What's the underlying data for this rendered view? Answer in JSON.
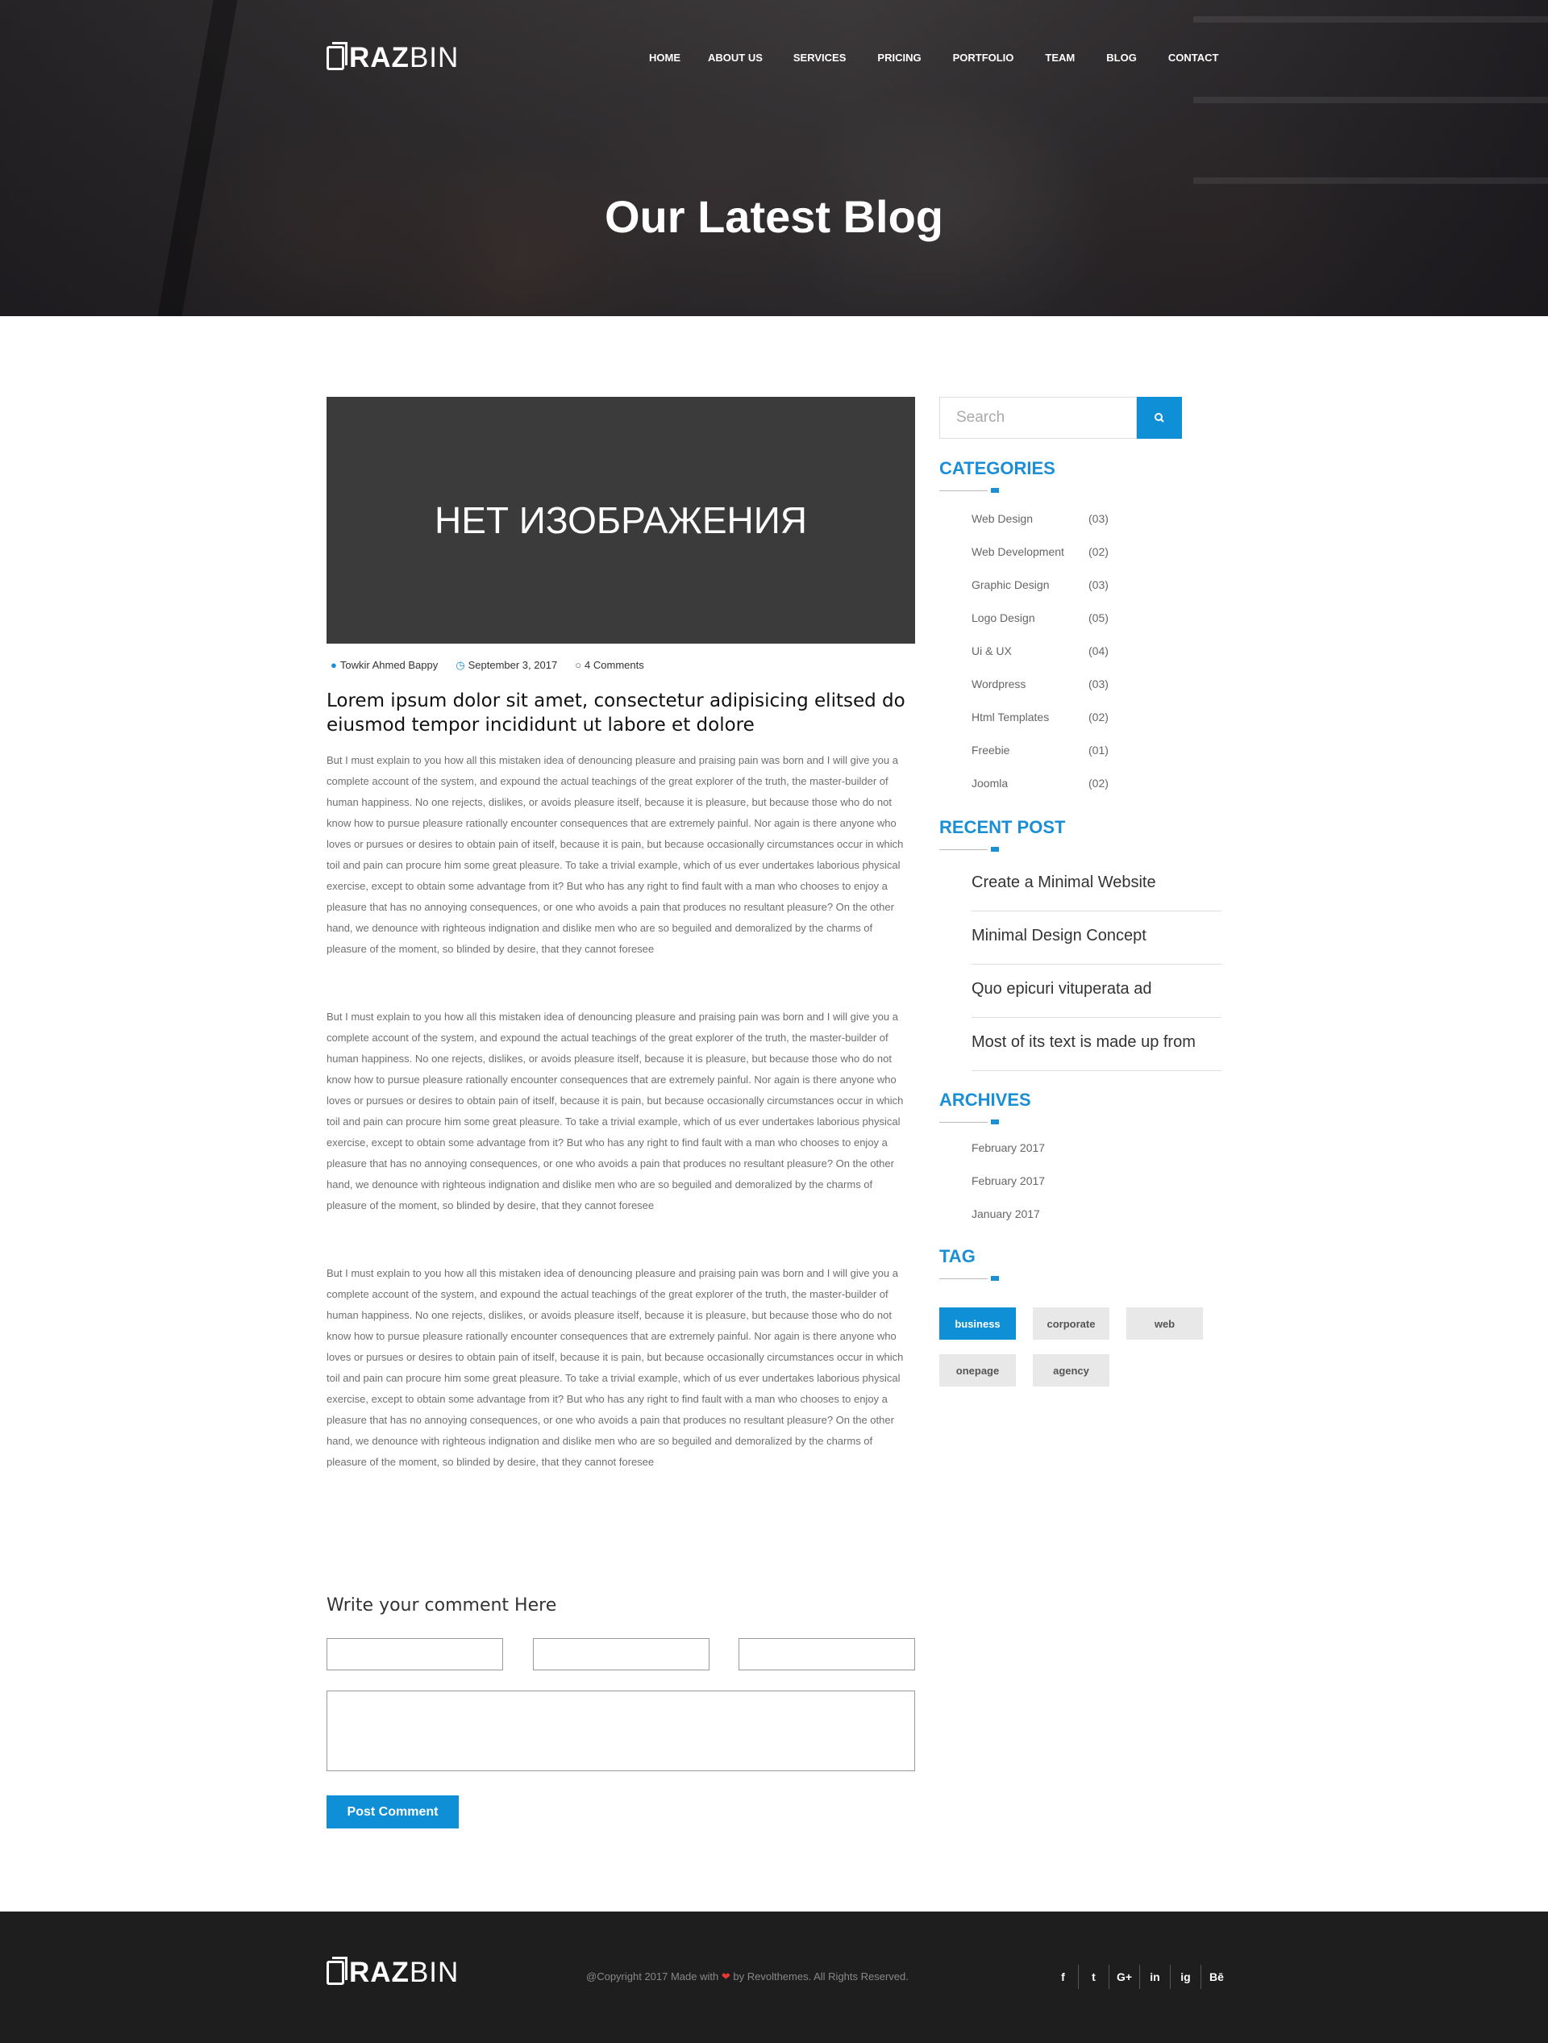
{
  "header": {
    "logo_bold": "RAZ",
    "logo_thin": "BIN",
    "nav": [
      "HOME",
      "ABOUT US",
      "SERVICES",
      "PRICING",
      "PORTFOLIO",
      "TEAM",
      "BLOG",
      "CONTACT"
    ],
    "hero_title": "Our Latest Blog"
  },
  "post": {
    "image_text": "НЕТ ИЗОБРАЖЕНИЯ",
    "author": "Towkir Ahmed Bappy",
    "date": "September 3, 2017",
    "comments": "4 Comments",
    "title": "Lorem ipsum dolor sit amet, consectetur adipisicing elitsed do eiusmod tempor incididunt ut labore et dolore",
    "paragraphs": [
      "But I must explain to you how all this mistaken idea of denouncing pleasure and praising pain was born and I will give you a complete account of the system, and expound the actual teachings of the great explorer of the truth, the master-builder of human happiness. No one rejects, dislikes, or avoids pleasure itself, because it is pleasure, but because those who do not know how to pursue pleasure rationally encounter consequences that are extremely painful. Nor again is there anyone who loves or pursues or desires to obtain pain of itself, because it is pain, but because occasionally circumstances occur in which toil and pain can procure him some great pleasure. To take a trivial example, which of us ever undertakes laborious physical exercise, except to obtain some advantage from it? But who has any right to find fault with a man who chooses to enjoy a pleasure that has no annoying consequences, or one who avoids a pain that produces no resultant pleasure? On the other hand, we denounce with righteous indignation and dislike men who are so beguiled and demoralized by the charms of pleasure of the moment, so blinded by desire, that they cannot foresee",
      "But I must explain to you how all this mistaken idea of denouncing pleasure and praising pain was born and I will give you a complete account of the system, and expound the actual teachings of the great explorer of the truth, the master-builder of human happiness. No one rejects, dislikes, or avoids pleasure itself, because it is pleasure, but because those who do not know how to pursue pleasure rationally encounter consequences that are extremely painful. Nor again is there anyone who loves or pursues or desires to obtain pain of itself, because it is pain, but because occasionally circumstances occur in which toil and pain can procure him some great pleasure. To take a trivial example, which of us ever undertakes laborious physical exercise, except to obtain some advantage from it? But who has any right to find fault with a man who chooses to enjoy a pleasure that has no annoying consequences, or one who avoids a pain that produces no resultant pleasure? On the other hand, we denounce with righteous indignation and dislike men who are so beguiled and demoralized by the charms of pleasure of the moment, so blinded by desire, that they cannot foresee",
      "But I must explain to you how all this mistaken idea of denouncing pleasure and praising pain was born and I will give you a complete account of the system, and expound the actual teachings of the great explorer of the truth, the master-builder of human happiness. No one rejects, dislikes, or avoids pleasure itself, because it is pleasure, but because those who do not know how to pursue pleasure rationally encounter consequences that are extremely painful. Nor again is there anyone who loves or pursues or desires to obtain pain of itself, because it is pain, but because occasionally circumstances occur in which toil and pain can procure him some great pleasure. To take a trivial example, which of us ever undertakes laborious physical exercise, except to obtain some advantage from it? But who has any right to find fault with a man who chooses to enjoy a pleasure that has no annoying consequences, or one who avoids a pain that produces no resultant pleasure? On the other hand, we denounce with righteous indignation and dislike men who are so beguiled and demoralized by the charms of pleasure of the moment, so blinded by desire, that they cannot foresee"
    ]
  },
  "comment_form": {
    "title": "Write your comment Here",
    "submit_label": "Post Comment"
  },
  "sidebar": {
    "search_placeholder": "Search",
    "categories_title": "CATEGORIES",
    "categories": [
      {
        "name": "Web Design",
        "count": "(03)"
      },
      {
        "name": "Web Development",
        "count": "(02)"
      },
      {
        "name": "Graphic Design",
        "count": "(03)"
      },
      {
        "name": "Logo Design",
        "count": "(05)"
      },
      {
        "name": "Ui & UX",
        "count": "(04)"
      },
      {
        "name": "Wordpress",
        "count": "(03)"
      },
      {
        "name": "Html Templates",
        "count": "(02)"
      },
      {
        "name": "Freebie",
        "count": "(01)"
      },
      {
        "name": "Joomla",
        "count": "(02)"
      }
    ],
    "recent_title": "RECENT POST",
    "recent": [
      "Create a Minimal Website",
      "Minimal Design Concept",
      "Quo epicuri vituperata ad",
      "Most of its text is made up from"
    ],
    "archives_title": "ARCHIVES",
    "archives": [
      "February 2017",
      "February 2017",
      "January 2017"
    ],
    "tag_title": "TAG",
    "tags": [
      "business",
      "corporate",
      "web",
      "onepage",
      "agency"
    ]
  },
  "footer": {
    "copy_before": "@Copyright 2017 Made with",
    "copy_after": "by Revolthemes. All Rights Reserved.",
    "social": [
      "f",
      "t",
      "G+",
      "in",
      "ig",
      "Bē"
    ]
  },
  "colors": {
    "accent": "#0e8fd6",
    "footer_bg": "#1e1e1e",
    "image_placeholder": "#3b3b3b"
  }
}
